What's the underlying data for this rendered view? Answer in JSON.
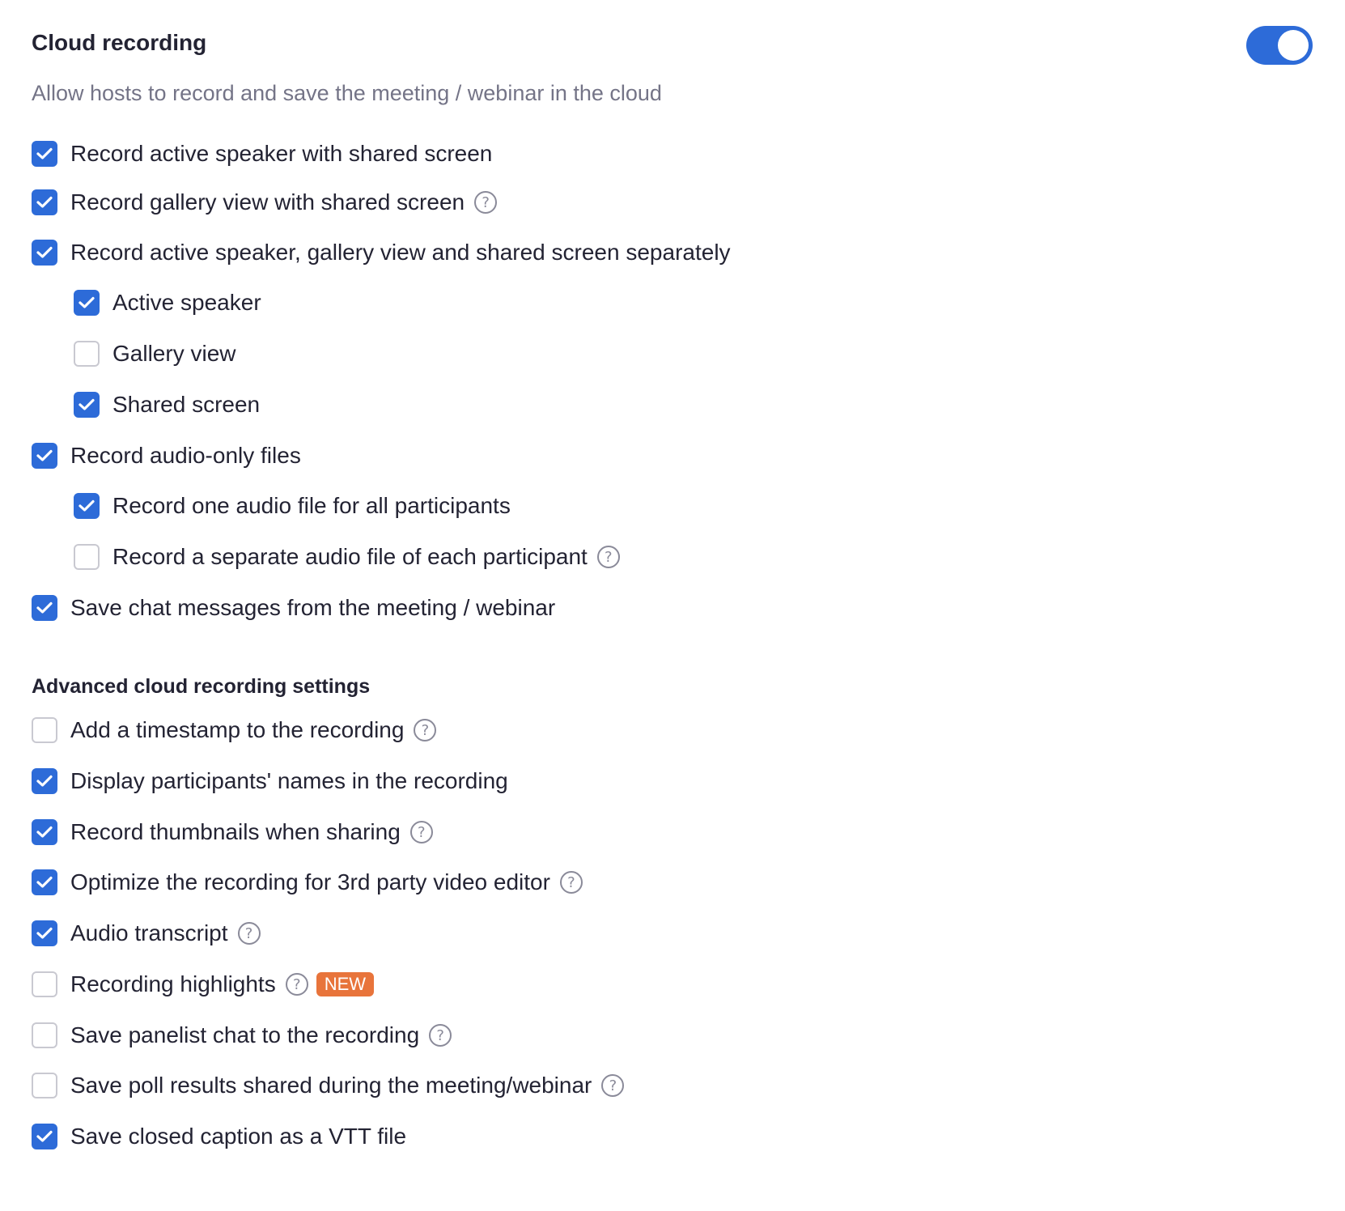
{
  "header": {
    "title": "Cloud recording",
    "toggle_on": true,
    "description": "Allow hosts to record and save the meeting / webinar in the cloud"
  },
  "options": [
    {
      "label": "Record active speaker with shared screen",
      "checked": true,
      "help": false
    },
    {
      "label": "Record gallery view with shared screen",
      "checked": true,
      "help": true
    },
    {
      "label": "Record active speaker, gallery view and shared screen separately",
      "checked": true,
      "help": false
    },
    {
      "label": "Active speaker",
      "checked": true,
      "help": false
    },
    {
      "label": "Gallery view",
      "checked": false,
      "help": false
    },
    {
      "label": "Shared screen",
      "checked": true,
      "help": false
    },
    {
      "label": "Record audio-only files",
      "checked": true,
      "help": false
    },
    {
      "label": "Record one audio file for all participants",
      "checked": true,
      "help": false
    },
    {
      "label": "Record a separate audio file of each participant",
      "checked": false,
      "help": true
    },
    {
      "label": "Save chat messages from the meeting / webinar",
      "checked": true,
      "help": false
    }
  ],
  "advanced": {
    "title": "Advanced cloud recording settings",
    "options": [
      {
        "label": "Add a timestamp to the recording",
        "checked": false,
        "help": true
      },
      {
        "label": "Display participants' names in the recording",
        "checked": true,
        "help": false
      },
      {
        "label": "Record thumbnails when sharing",
        "checked": true,
        "help": true
      },
      {
        "label": "Optimize the recording for 3rd party video editor",
        "checked": true,
        "help": true
      },
      {
        "label": "Audio transcript",
        "checked": true,
        "help": true
      },
      {
        "label": "Recording highlights",
        "checked": false,
        "help": true,
        "badge": "NEW"
      },
      {
        "label": "Save panelist chat to the recording",
        "checked": false,
        "help": true
      },
      {
        "label": "Save poll results shared during the meeting/webinar",
        "checked": false,
        "help": true
      },
      {
        "label": "Save closed caption as a VTT file",
        "checked": true,
        "help": false
      }
    ]
  },
  "help_glyph": "?",
  "colors": {
    "accent": "#2d6bd8",
    "badge": "#e8743b",
    "text": "#232333",
    "muted": "#747487"
  },
  "icons": {
    "check": "check-icon",
    "help": "help-icon"
  }
}
